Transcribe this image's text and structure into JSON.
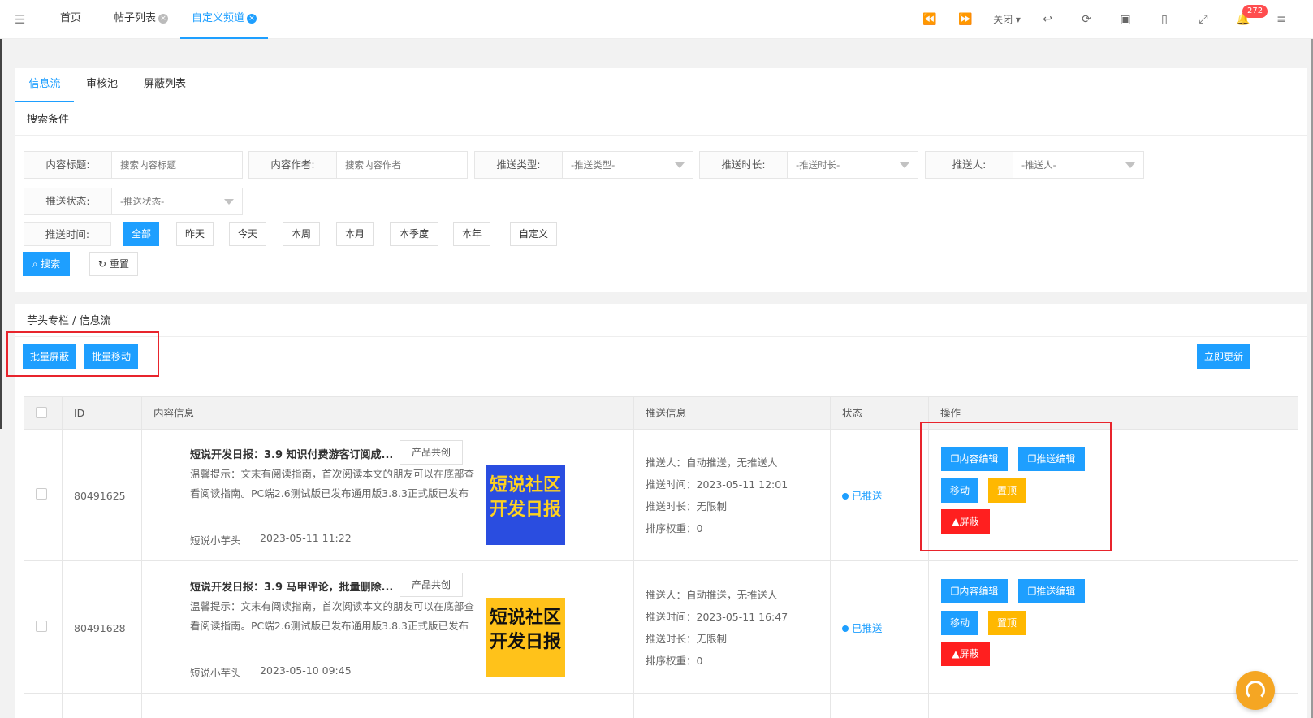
{
  "topbar": {
    "tabs": [
      {
        "label": "首页"
      },
      {
        "label": "帖子列表"
      },
      {
        "label": "自定义频道"
      }
    ],
    "close_label": "关闭",
    "notification_count": "272"
  },
  "subtabs": [
    "信息流",
    "审核池",
    "屏蔽列表"
  ],
  "search": {
    "title": "搜索条件",
    "fields": {
      "title": {
        "label": "内容标题:",
        "placeholder": "搜索内容标题"
      },
      "author": {
        "label": "内容作者:",
        "placeholder": "搜索内容作者"
      },
      "push_type": {
        "label": "推送类型:",
        "value": "-推送类型-"
      },
      "push_duration": {
        "label": "推送时长:",
        "value": "-推送时长-"
      },
      "pusher": {
        "label": "推送人:",
        "value": "-推送人-"
      },
      "push_status": {
        "label": "推送状态:",
        "value": "-推送状态-"
      }
    },
    "time_label": "推送时间:",
    "time_options": [
      "全部",
      "昨天",
      "今天",
      "本周",
      "本月",
      "本季度",
      "本年",
      "自定义"
    ],
    "search_button": "搜索",
    "reset_button": "重置"
  },
  "list": {
    "breadcrumb": "芋头专栏 / 信息流",
    "batch_block": "批量屏蔽",
    "batch_move": "批量移动",
    "refresh_now": "立即更新",
    "headers": {
      "id": "ID",
      "content": "内容信息",
      "push": "推送信息",
      "status": "状态",
      "ops": "操作"
    },
    "rows": [
      {
        "id": "80491625",
        "title": "短说开发日报：3.9 知识付费游客订阅成...",
        "tag": "产品共创",
        "desc": "温馨提示：文末有阅读指南，首次阅读本文的朋友可以在底部查看阅读指南。PC端2.6测试版已发布通用版3.8.3正式版已发布",
        "author": "短说小芋头",
        "time": "2023-05-11 11:22",
        "thumb_text_1": "短说社区",
        "thumb_text_2": "开发日报",
        "thumb_bg": "#2a4de0",
        "thumb_fg": "#ffd21f",
        "pusher": "推送人：自动推送，无推送人",
        "push_time": "推送时间：2023-05-11 12:01",
        "push_duration": "推送时长：无限制",
        "sort_weight": "排序权重：0",
        "status": "已推送"
      },
      {
        "id": "80491628",
        "title": "短说开发日报：3.9 马甲评论，批量删除...",
        "tag": "产品共创",
        "desc": "温馨提示：文末有阅读指南，首次阅读本文的朋友可以在底部查看阅读指南。PC端2.6测试版已发布通用版3.8.3正式版已发布",
        "author": "短说小芋头",
        "time": "2023-05-10 09:45",
        "thumb_text_1": "短说社区",
        "thumb_text_2": "开发日报",
        "thumb_bg": "#ffc21a",
        "thumb_fg": "#111111",
        "pusher": "推送人：自动推送，无推送人",
        "push_time": "推送时间：2023-05-11 16:47",
        "push_duration": "推送时长：无限制",
        "sort_weight": "排序权重：0",
        "status": "已推送"
      }
    ],
    "actions": {
      "edit_content": "内容编辑",
      "edit_push": "推送编辑",
      "move": "移动",
      "pin": "置顶",
      "block": "屏蔽"
    }
  }
}
